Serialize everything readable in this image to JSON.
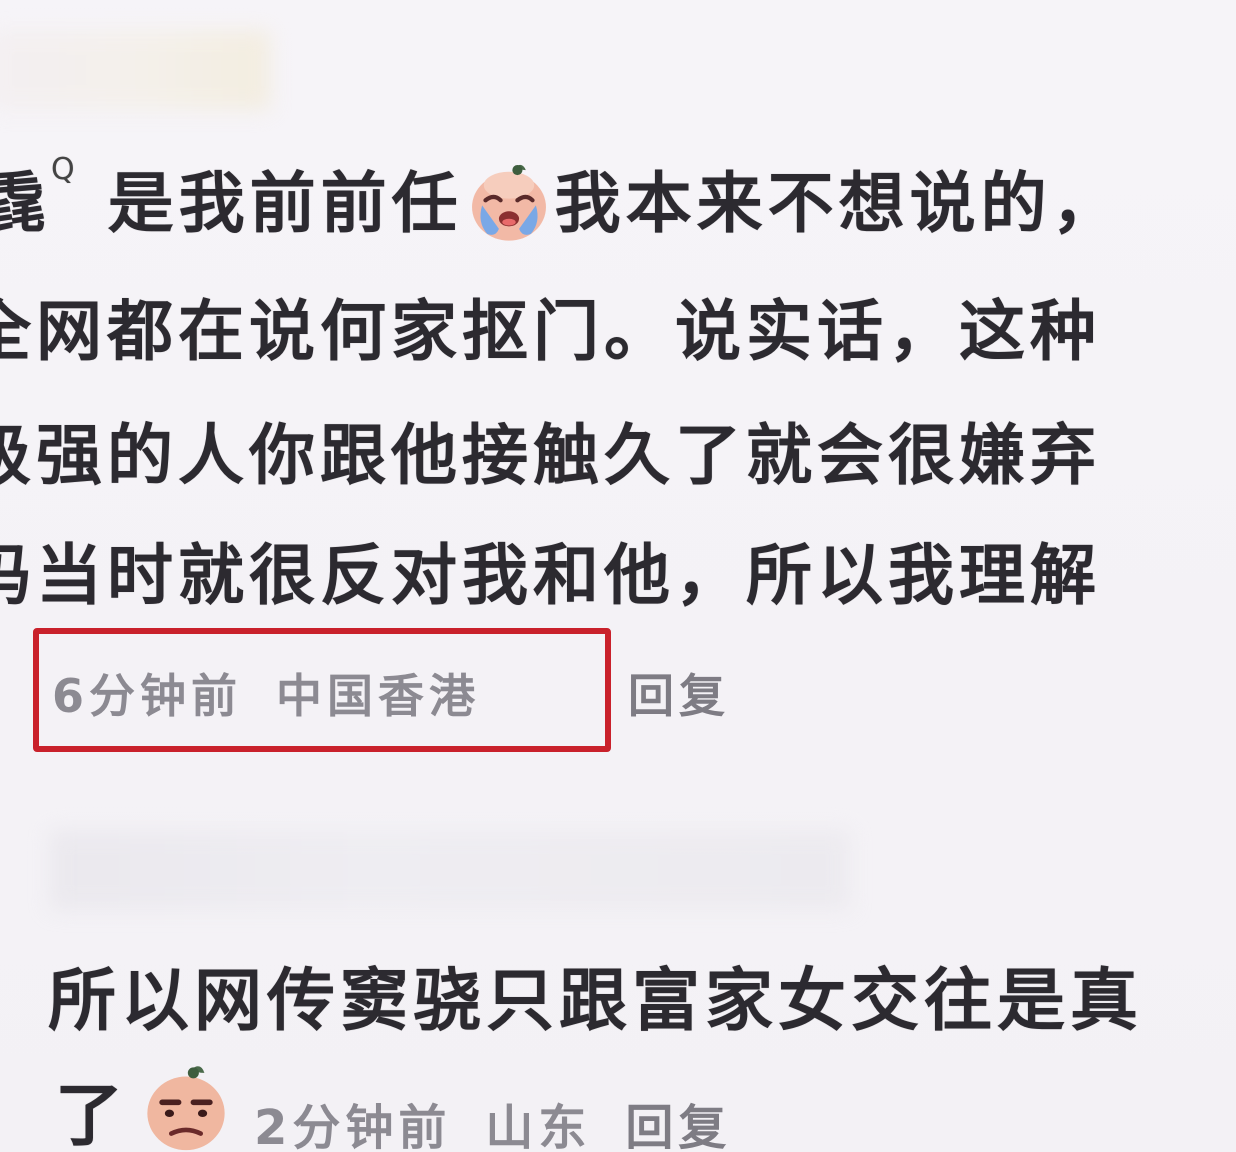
{
  "comment1": {
    "line1_prefix": "毳",
    "line1_mention": "Q",
    "line1_part1": "是我前前任",
    "line1_emoji": "crying-face-emoji",
    "line1_part2": "我本来不想说的，",
    "line2": "全网都在说何家抠门。说实话，这种",
    "line3": "级强的人你跟他接触久了就会很嫌弃",
    "line4": "妈当时就很反对我和他，所以我理解",
    "time": "6分钟前",
    "location": "中国香港",
    "reply_label": "回复"
  },
  "comment2": {
    "line1": "所以网传窦骁只跟富家女交往是真",
    "line2_text": "了",
    "line2_emoji": "grimace-face-emoji",
    "time": "2分钟前",
    "location": "山东",
    "reply_label": "回复"
  },
  "colors": {
    "highlight_border": "#c9212b",
    "meta_text": "#8c8a92",
    "body_text": "#2c2a30"
  }
}
